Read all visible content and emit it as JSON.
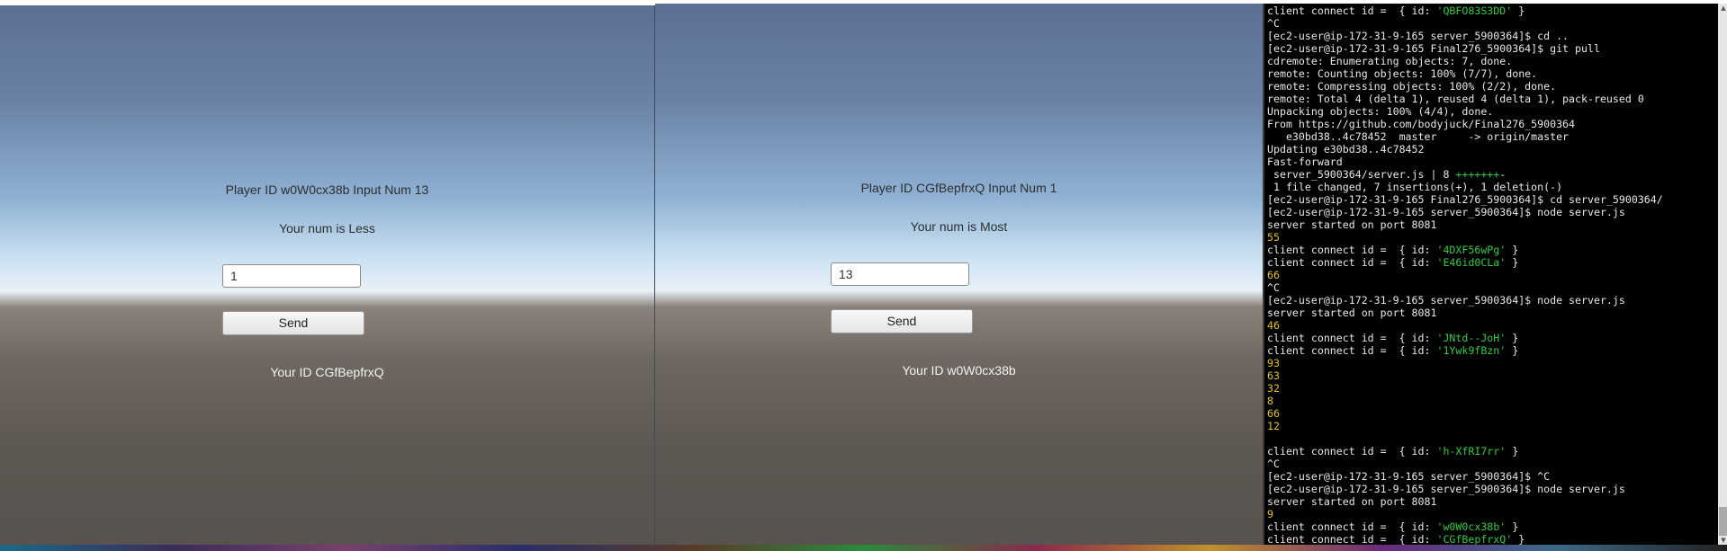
{
  "left_game": {
    "title": "Player ID w0W0cx38b Input Num 13",
    "result": "Your num is Less",
    "input_value": "1",
    "send_label": "Send",
    "your_id": "Your ID CGfBepfrxQ"
  },
  "right_game": {
    "title": "Player ID CGfBepfrxQ Input Num 1",
    "result": "Your num is Most",
    "input_value": "13",
    "send_label": "Send",
    "your_id": "Your ID w0W0cx38b"
  },
  "terminal": {
    "lines": [
      {
        "pre": "client connect id =  { id: ",
        "hl": "'QBFO83S3DD'",
        "post": " }"
      },
      {
        "text": "^C"
      },
      {
        "text": "[ec2-user@ip-172-31-9-165 server_5900364]$ cd .."
      },
      {
        "text": "[ec2-user@ip-172-31-9-165 Final276_5900364]$ git pull"
      },
      {
        "text": "cdremote: Enumerating objects: 7, done."
      },
      {
        "text": "remote: Counting objects: 100% (7/7), done."
      },
      {
        "text": "remote: Compressing objects: 100% (2/2), done."
      },
      {
        "text": "remote: Total 4 (delta 1), reused 4 (delta 1), pack-reused 0"
      },
      {
        "text": "Unpacking objects: 100% (4/4), done."
      },
      {
        "text": "From https://github.com/bodyjuck/Final276_5900364"
      },
      {
        "text": "   e30bd38..4c78452  master     -> origin/master"
      },
      {
        "text": "Updating e30bd38..4c78452"
      },
      {
        "text": "Fast-forward"
      },
      {
        "pre": " server_5900364/server.js | 8 ",
        "hl": "+++++++",
        "post": "-"
      },
      {
        "text": " 1 file changed, 7 insertions(+), 1 deletion(-)"
      },
      {
        "text": "[ec2-user@ip-172-31-9-165 Final276_5900364]$ cd server_5900364/"
      },
      {
        "text": "[ec2-user@ip-172-31-9-165 server_5900364]$ node server.js"
      },
      {
        "text": "server started on port 8081"
      },
      {
        "text": "55",
        "color": "yellow"
      },
      {
        "pre": "client connect id =  { id: ",
        "hl": "'4DXF56wPg'",
        "post": " }"
      },
      {
        "pre": "client connect id =  { id: ",
        "hl": "'E46id0CLa'",
        "post": " }"
      },
      {
        "text": "66",
        "color": "yellow"
      },
      {
        "text": "^C"
      },
      {
        "text": "[ec2-user@ip-172-31-9-165 server_5900364]$ node server.js"
      },
      {
        "text": "server started on port 8081"
      },
      {
        "text": "46",
        "color": "yellow"
      },
      {
        "pre": "client connect id =  { id: ",
        "hl": "'JNtd--JoH'",
        "post": " }"
      },
      {
        "pre": "client connect id =  { id: ",
        "hl": "'1Ywk9fBzn'",
        "post": " }"
      },
      {
        "text": "93",
        "color": "yellow"
      },
      {
        "text": "63",
        "color": "yellow"
      },
      {
        "text": "32",
        "color": "yellow"
      },
      {
        "text": "8",
        "color": "yellow"
      },
      {
        "text": "66",
        "color": "yellow"
      },
      {
        "text": "12",
        "color": "yellow"
      },
      {
        "text": ""
      },
      {
        "pre": "client connect id =  { id: ",
        "hl": "'h-XfRI7rr'",
        "post": " }"
      },
      {
        "text": "^C"
      },
      {
        "text": "[ec2-user@ip-172-31-9-165 server_5900364]$ ^C"
      },
      {
        "text": "[ec2-user@ip-172-31-9-165 server_5900364]$ node server.js"
      },
      {
        "text": "server started on port 8081"
      },
      {
        "text": "9",
        "color": "yellow"
      },
      {
        "pre": "client connect id =  { id: ",
        "hl": "'w0W0cx38b'",
        "post": " }"
      },
      {
        "pre": "client connect id =  { id: ",
        "hl": "'CGfBepfrxQ'",
        "post": " }"
      }
    ]
  }
}
